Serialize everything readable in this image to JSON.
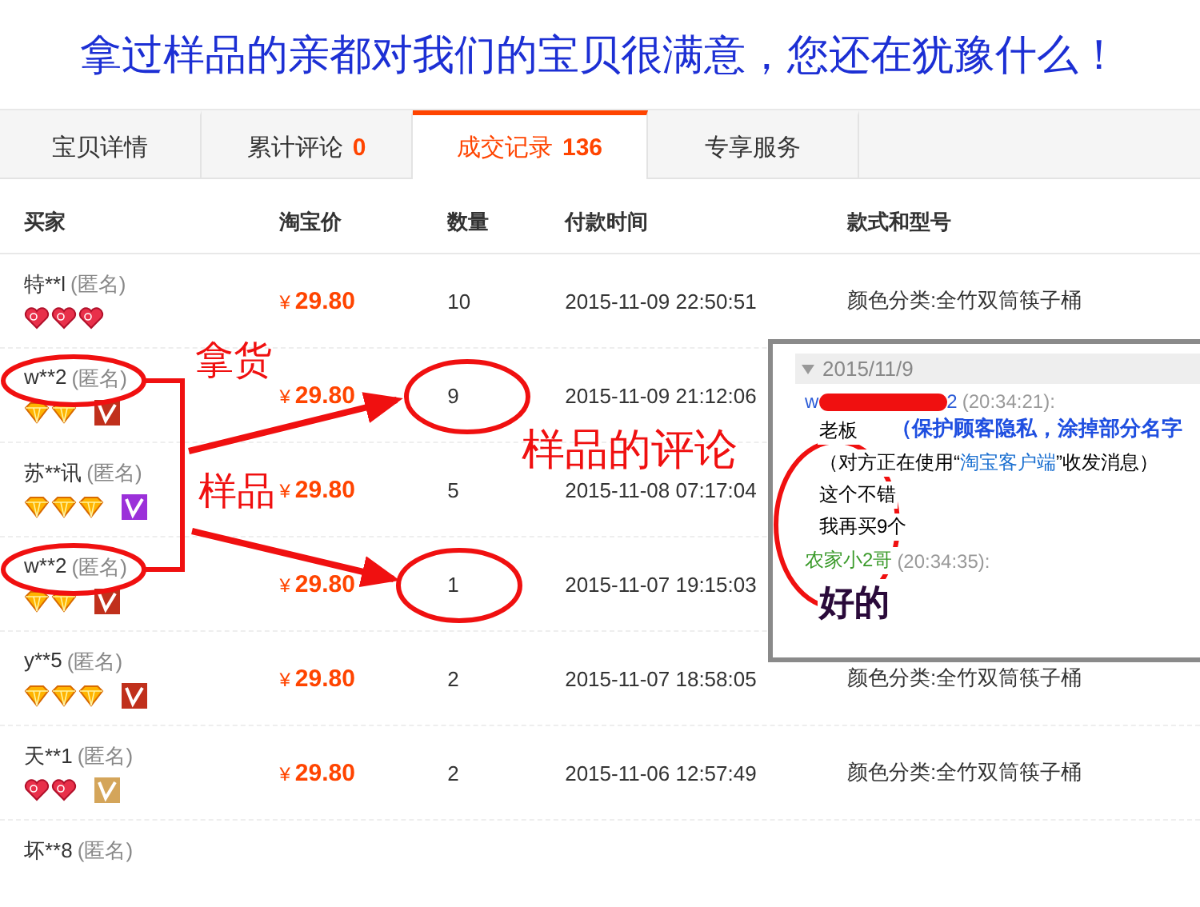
{
  "banner": {
    "text": "拿过样品的亲都对我们的宝贝很满意，您还在犹豫什么！"
  },
  "tabs": [
    {
      "label": "宝贝详情",
      "selected": false
    },
    {
      "label": "累计评论",
      "count": "0",
      "selected": false
    },
    {
      "label": "成交记录",
      "count": "136",
      "selected": true
    },
    {
      "label": "专享服务",
      "selected": false
    }
  ],
  "table": {
    "columns": [
      "买家",
      "淘宝价",
      "数量",
      "付款时间",
      "款式和型号"
    ],
    "rows": [
      {
        "buyer": "特**l",
        "anonymous": "(匿名)",
        "badges": [
          {
            "kind": "heart"
          },
          {
            "kind": "heart"
          },
          {
            "kind": "heart"
          }
        ],
        "currency": "¥",
        "price": "29.80",
        "quantity": "10",
        "time": "2015-11-09 22:50:51",
        "style": "颜色分类:全竹双筒筷子桶"
      },
      {
        "buyer": "w**2",
        "anonymous": "(匿名)",
        "badges": [
          {
            "kind": "diamond"
          },
          {
            "kind": "diamond"
          }
        ],
        "vip": {
          "color": "#c0301c"
        },
        "currency": "¥",
        "price": "29.80",
        "quantity": "9",
        "time": "2015-11-09 21:12:06"
      },
      {
        "buyer": "苏**讯",
        "anonymous": "(匿名)",
        "badges": [
          {
            "kind": "diamond"
          },
          {
            "kind": "diamond"
          },
          {
            "kind": "diamond"
          }
        ],
        "vip": {
          "color": "#9b30d9"
        },
        "currency": "¥",
        "price": "29.80",
        "quantity": "5",
        "time": "2015-11-08 07:17:04"
      },
      {
        "buyer": "w**2",
        "anonymous": "(匿名)",
        "badges": [
          {
            "kind": "diamond"
          },
          {
            "kind": "diamond"
          }
        ],
        "vip": {
          "color": "#c0301c"
        },
        "currency": "¥",
        "price": "29.80",
        "quantity": "1",
        "time": "2015-11-07 19:15:03"
      },
      {
        "buyer": "y**5",
        "anonymous": "(匿名)",
        "badges": [
          {
            "kind": "diamond"
          },
          {
            "kind": "diamond"
          },
          {
            "kind": "diamond"
          }
        ],
        "vip": {
          "color": "#c0301c"
        },
        "currency": "¥",
        "price": "29.80",
        "quantity": "2",
        "time": "2015-11-07 18:58:05",
        "style": "颜色分类:全竹双筒筷子桶"
      },
      {
        "buyer": "天**1",
        "anonymous": "(匿名)",
        "badges": [
          {
            "kind": "heart"
          },
          {
            "kind": "heart"
          }
        ],
        "vip": {
          "color": "#d4a55a"
        },
        "currency": "¥",
        "price": "29.80",
        "quantity": "2",
        "time": "2015-11-06 12:57:49",
        "style": "颜色分类:全竹双筒筷子桶"
      },
      {
        "buyer": "坏**8",
        "anonymous": "(匿名)",
        "badges": []
      }
    ]
  },
  "chat": {
    "date": "2015/11/9",
    "messages": [
      {
        "kind": "customer",
        "sender_start": "w",
        "sender_end": "2",
        "time": "(20:34:21):",
        "note": "（保护顾客隐私，涂掉部分名字",
        "lines": [
          {
            "text": "老板"
          },
          {
            "text": "（对方正在使用“",
            "link": "淘宝客户端",
            "after": "”收发消息）"
          },
          {
            "text": "这个不错"
          },
          {
            "text": "我再买9个"
          }
        ]
      },
      {
        "kind": "seller",
        "sender_start": "农家小2哥",
        "time": "(20:34:35):",
        "lines": [
          {
            "text": "好的"
          }
        ]
      }
    ]
  },
  "annotations": {
    "labels": [
      "拿货",
      "样品",
      "样品的评论"
    ]
  }
}
